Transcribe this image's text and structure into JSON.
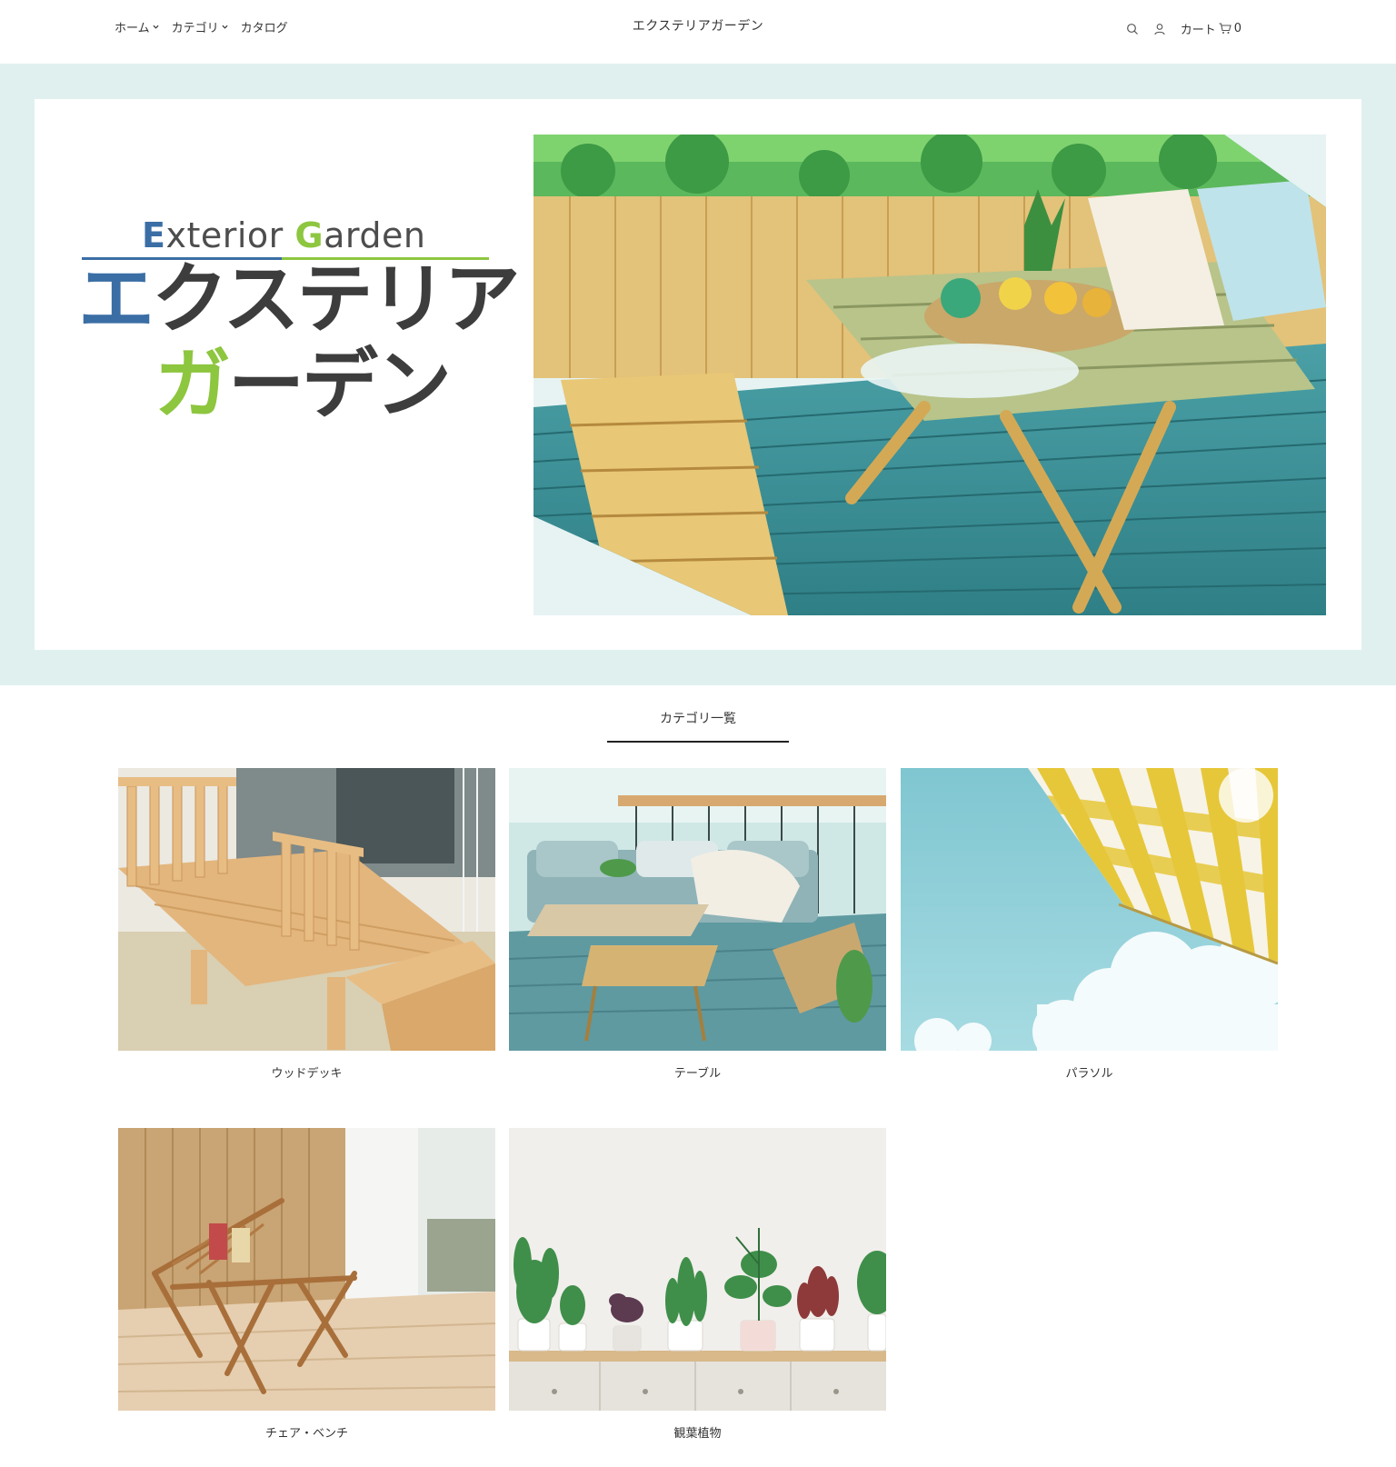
{
  "header": {
    "nav": [
      {
        "label": "ホーム",
        "dropdown": true
      },
      {
        "label": "カテゴリ",
        "dropdown": true
      },
      {
        "label": "カタログ",
        "dropdown": false
      }
    ],
    "site_title": "エクステリアガーデン",
    "cart_label": "カート",
    "cart_count": "0"
  },
  "hero": {
    "logo_en_first": "E",
    "logo_en_mid": "xterior ",
    "logo_en_g": "G",
    "logo_en_rest": "arden",
    "logo_jp_first": "エ",
    "logo_jp_rest": "クステリア",
    "logo_jp2_first": "ガ",
    "logo_jp2_rest": "ーデン",
    "background_color": "#dff0ef"
  },
  "categories": {
    "heading": "カテゴリ一覧",
    "items": [
      {
        "label": "ウッドデッキ"
      },
      {
        "label": "テーブル"
      },
      {
        "label": "パラソル"
      },
      {
        "label": "チェア・ベンチ"
      },
      {
        "label": "観葉植物"
      }
    ]
  },
  "colors": {
    "brand_blue": "#3a6ea5",
    "brand_green": "#8dc63f",
    "text": "#333333"
  }
}
